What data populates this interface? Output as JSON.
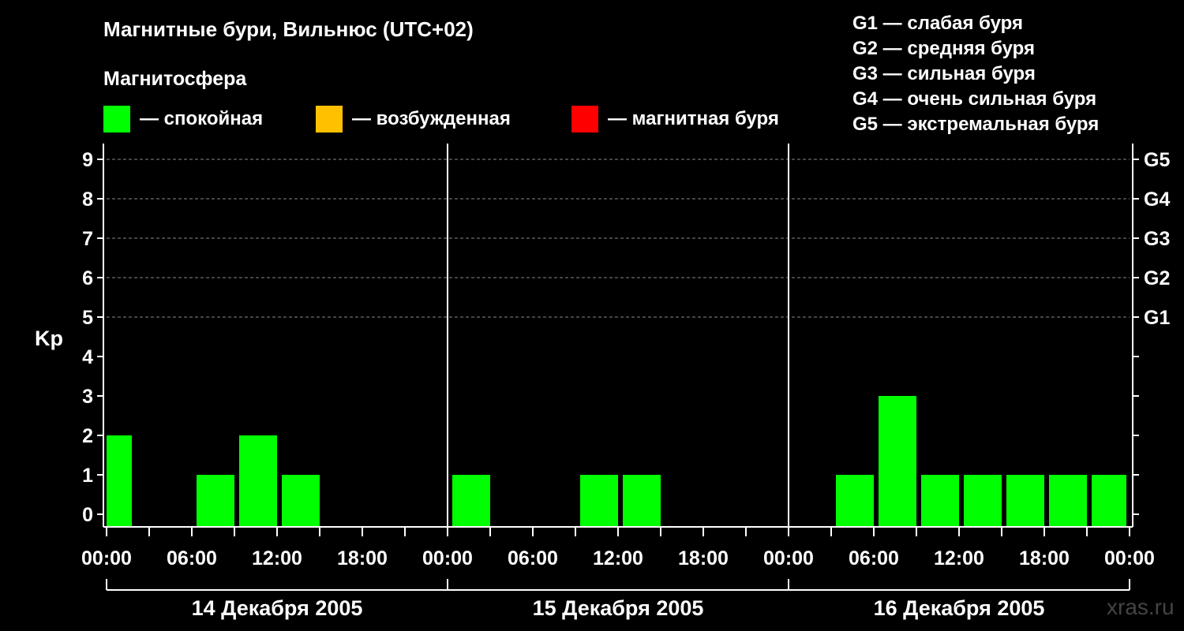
{
  "header": {
    "title": "Магнитные бури, Вильнюс (UTC+02)",
    "subtitle": "Магнитосфера"
  },
  "legend": [
    {
      "label": "— спокойная",
      "color": "#00ff00"
    },
    {
      "label": "— возбужденная",
      "color": "#ffc000"
    },
    {
      "label": "— магнитная буря",
      "color": "#ff0000"
    }
  ],
  "storm_levels": [
    "G1 — слабая буря",
    "G2 — средняя буря",
    "G3 — сильная буря",
    "G4 — очень сильная буря",
    "G5 — экстремальная буря"
  ],
  "watermark": "xras.ru",
  "chart_data": {
    "type": "bar",
    "ylabel": "Kp",
    "ylim": [
      0,
      9
    ],
    "yticks": [
      "0",
      "1",
      "2",
      "3",
      "4",
      "5",
      "6",
      "7",
      "8",
      "9"
    ],
    "right_ticks": [
      {
        "kp": 5,
        "label": "G1"
      },
      {
        "kp": 6,
        "label": "G2"
      },
      {
        "kp": 7,
        "label": "G3"
      },
      {
        "kp": 8,
        "label": "G4"
      },
      {
        "kp": 9,
        "label": "G5"
      }
    ],
    "xtick_labels": [
      "00:00",
      "06:00",
      "12:00",
      "18:00",
      "00:00",
      "06:00",
      "12:00",
      "18:00",
      "00:00",
      "06:00",
      "12:00",
      "18:00",
      "00:00"
    ],
    "days": [
      "14 Декабря 2005",
      "15 Декабря 2005",
      "16 Декабря 2005"
    ],
    "interval_hours": 3,
    "bar_color": "#00ff00",
    "values": [
      2,
      0,
      1,
      2,
      1,
      0,
      0,
      0,
      1,
      0,
      0,
      1,
      1,
      0,
      0,
      0,
      0,
      1,
      3,
      1,
      1,
      1,
      1,
      1
    ],
    "grid": true
  }
}
